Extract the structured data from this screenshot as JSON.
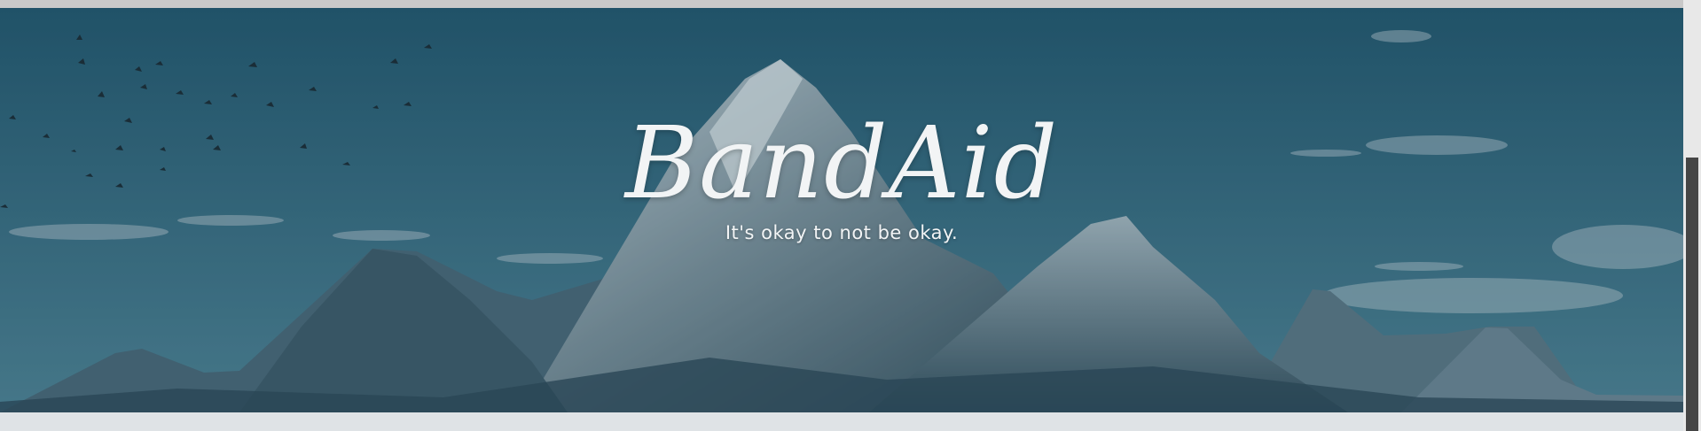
{
  "hero": {
    "title": "BandAid",
    "tagline": "It's okay to not be okay."
  },
  "colors": {
    "sky_top": "#22576e",
    "sky_bottom": "#4f8496",
    "mountain_dark": "#2d4957",
    "mountain_mid": "#536f7c",
    "snow": "#c9d5db",
    "text": "#f2f4f5",
    "scroll_thumb": "#454545"
  },
  "icons": [
    "bird-flock-decoration"
  ]
}
